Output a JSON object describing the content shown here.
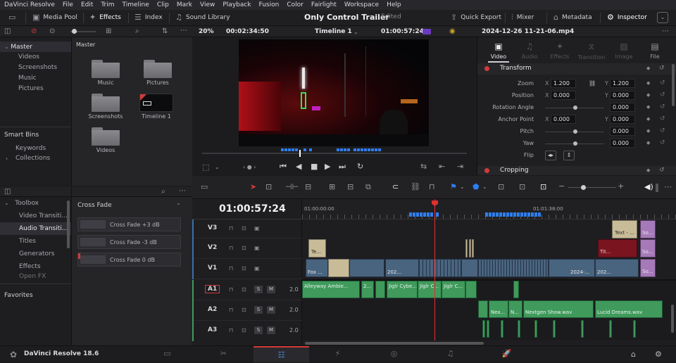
{
  "menu": [
    "DaVinci Resolve",
    "File",
    "Edit",
    "Trim",
    "Timeline",
    "Clip",
    "Mark",
    "View",
    "Playback",
    "Fusion",
    "Color",
    "Fairlight",
    "Workspace",
    "Help"
  ],
  "topbar": {
    "media_pool": "Media Pool",
    "effects": "Effects",
    "index": "Index",
    "sound_library": "Sound Library",
    "project_title": "Only Control Trailer",
    "edited": "Edited",
    "quick_export": "Quick Export",
    "mixer": "Mixer",
    "metadata": "Metadata",
    "inspector": "Inspector"
  },
  "viewer_bar": {
    "zoom": "20%",
    "source_tc": "00:02:34:50",
    "timeline_name": "Timeline 1",
    "record_tc": "01:00:57:24",
    "clip_name": "2024-12-26 11-21-06.mp4"
  },
  "media_pool": {
    "root": "Master",
    "bins": [
      "Videos",
      "Screenshots",
      "Music",
      "Pictures"
    ],
    "smart_bins_title": "Smart Bins",
    "smart_bins": [
      "Keywords",
      "Collections"
    ],
    "header": "Master",
    "items": [
      {
        "label": "Music",
        "type": "folder"
      },
      {
        "label": "Pictures",
        "type": "folder"
      },
      {
        "label": "Screenshots",
        "type": "folder"
      },
      {
        "label": "Timeline 1",
        "type": "timeline"
      },
      {
        "label": "Videos",
        "type": "folder"
      }
    ]
  },
  "inspector": {
    "tabs": [
      "Video",
      "Audio",
      "Effects",
      "Transition",
      "Image",
      "File"
    ],
    "active_tab": "Video",
    "transform_title": "Transform",
    "zoom_label": "Zoom",
    "zoom_x": "1.200",
    "zoom_y": "1.200",
    "position_label": "Position",
    "position_x": "0.000",
    "position_y": "0.000",
    "rotation_label": "Rotation Angle",
    "rotation": "0.000",
    "anchor_label": "Anchor Point",
    "anchor_x": "0.000",
    "anchor_y": "0.000",
    "pitch_label": "Pitch",
    "pitch": "0.000",
    "yaw_label": "Yaw",
    "yaw": "0.000",
    "flip_label": "Flip",
    "cropping_title": "Cropping",
    "axis_x": "X",
    "axis_y": "Y"
  },
  "effects": {
    "toolbox": "Toolbox",
    "categories": [
      "Video Transiti...",
      "Audio Transiti...",
      "Titles",
      "Generators",
      "Effects",
      "Open FX"
    ],
    "selected": "Audio Transiti...",
    "favorites": "Favorites",
    "group_title": "Cross Fade",
    "items": [
      "Cross Fade +3 dB",
      "Cross Fade -3 dB",
      "Cross Fade 0 dB"
    ]
  },
  "timeline": {
    "timecode": "01:00:57:24",
    "ruler": [
      "01:00:00:00",
      "01:01:38:00"
    ],
    "tracks": {
      "v3": "V3",
      "v2": "V2",
      "v1": "V1",
      "a1": "A1",
      "a2": "A2",
      "a3": "A3",
      "a1_level": "2.0",
      "a2_level": "2.0",
      "a3_level": "2.0",
      "s": "S",
      "m": "M"
    },
    "clips": {
      "v3_text": "Text - ...",
      "v3_so": "So...",
      "v2_te": "Te...",
      "v2_tit": "Tit...",
      "v2_so": "So...",
      "v1_fox": "Fox ...",
      "v1_2024a": "202...",
      "v1_2024b": "2024-...",
      "v1_2024c": "202...",
      "v1_so": "So...",
      "a1_alleyway": "Alleyway Ambie...",
      "a1_2": "2...",
      "a1_jiglr1": "Jiglr Cybe...",
      "a1_jiglr2": "Jiglr C...",
      "a1_jiglr3": "Jiglr C...",
      "a2_nex1": "Nex...",
      "a2_n": "N...",
      "a2_nextgen": "Nextgen Show.wav",
      "a2_lucid": "Lucid Dreams.wav"
    }
  },
  "bottom": {
    "app_name": "DaVinci Resolve 18.6",
    "pages": [
      "media",
      "cut",
      "edit",
      "fusion",
      "color",
      "fairlight",
      "deliver"
    ],
    "active_page": "edit"
  },
  "colors": {
    "accent_red": "#d23a3a",
    "video_clip": "#49647f",
    "audio_clip": "#3f9a5c",
    "marker_blue": "#2f7ef0"
  }
}
